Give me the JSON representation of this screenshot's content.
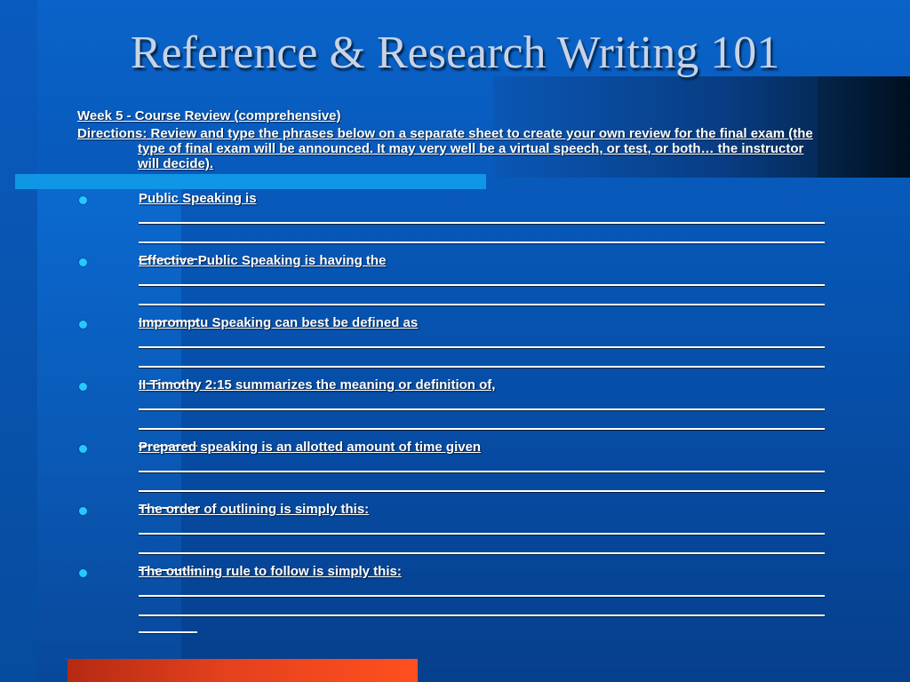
{
  "slide": {
    "title": "Reference & Research Writing 101",
    "subtitle": "Week 5 - Course Review (comprehensive)",
    "directions": "Directions: Review  and type the phrases below on a separate sheet to create your own review for the final exam (the type of final exam will be announced. It may very well be a virtual speech, or test, or both… the instructor will decide).",
    "items": [
      {
        "prompt": "Public Speaking is"
      },
      {
        "prompt": "Effective Public Speaking is having the"
      },
      {
        "prompt": "Impromptu Speaking can best be defined as"
      },
      {
        "prompt": "II Timothy 2:15 summarizes the meaning or definition of,"
      },
      {
        "prompt": "Prepared speaking is an allotted amount of time given"
      },
      {
        "prompt": "The order of outlining is simply this:"
      },
      {
        "prompt": "The outlining rule to follow is simply this:"
      }
    ]
  },
  "colors": {
    "background": "#0653b0",
    "accent_cyan": "#0f96e4",
    "accent_orange": "#ff4f1e",
    "bullet": "#28c8ff",
    "title_text": "#c7d3e6"
  }
}
